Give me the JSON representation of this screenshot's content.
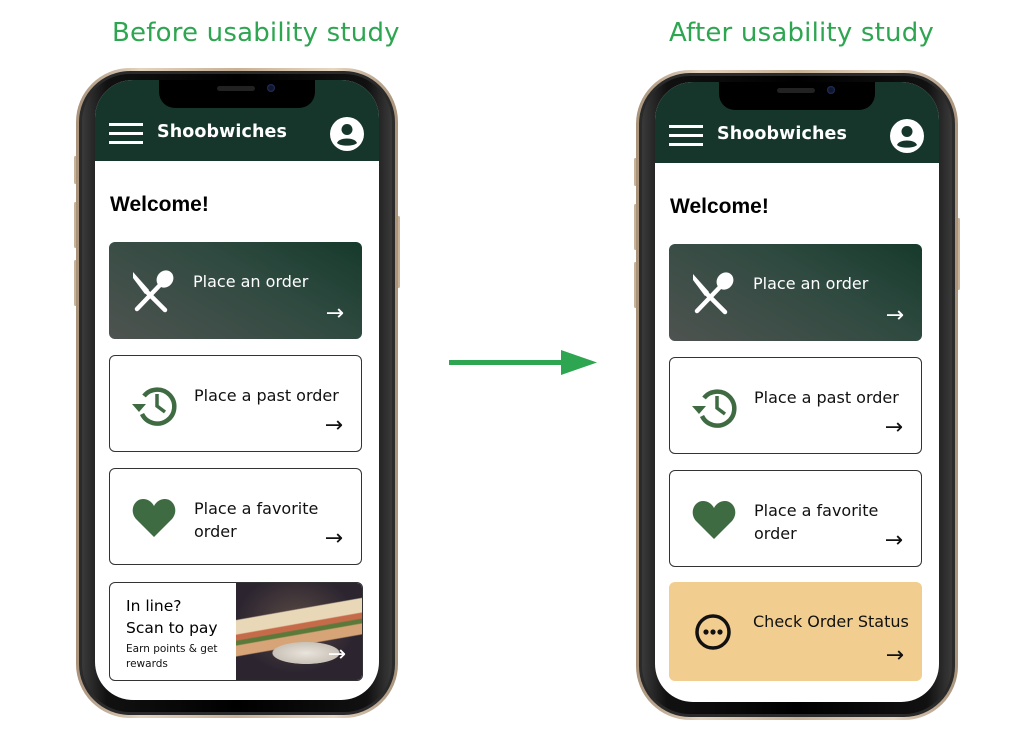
{
  "captions": {
    "before": "Before usability study",
    "after": "After usability study"
  },
  "colors": {
    "caption_green": "#2ea651",
    "header_green": "#17362b",
    "icon_green": "#3f6b43",
    "gold_card": "#f1cd90",
    "arrow_green": "#2ea651"
  },
  "before": {
    "app_title": "Shoobwiches",
    "menu_icon": "hamburger-menu-icon",
    "profile_icon": "user-profile-icon",
    "welcome": "Welcome!",
    "cards": [
      {
        "label": "Place an order",
        "icon": "fork-spoon-icon",
        "arrow": "→"
      },
      {
        "label": "Place a past order",
        "icon": "history-icon",
        "arrow": "→"
      },
      {
        "label": "Place a favorite order",
        "icon": "heart-icon",
        "arrow": "→"
      }
    ],
    "promo": {
      "line1": "In line?",
      "line2": "Scan to pay",
      "sub": "Earn points & get rewards",
      "image": "sandwich-photo",
      "arrow": "→"
    }
  },
  "after": {
    "app_title": "Shoobwiches",
    "menu_icon": "hamburger-menu-icon",
    "profile_icon": "user-profile-icon",
    "welcome": "Welcome!",
    "cards": [
      {
        "label": "Place an order",
        "icon": "fork-spoon-icon",
        "arrow": "→"
      },
      {
        "label": "Place a past order",
        "icon": "history-icon",
        "arrow": "→"
      },
      {
        "label": "Place a favorite order",
        "icon": "heart-icon",
        "arrow": "→"
      },
      {
        "label": "Check Order Status",
        "icon": "more-dots-icon",
        "arrow": "→"
      }
    ]
  }
}
